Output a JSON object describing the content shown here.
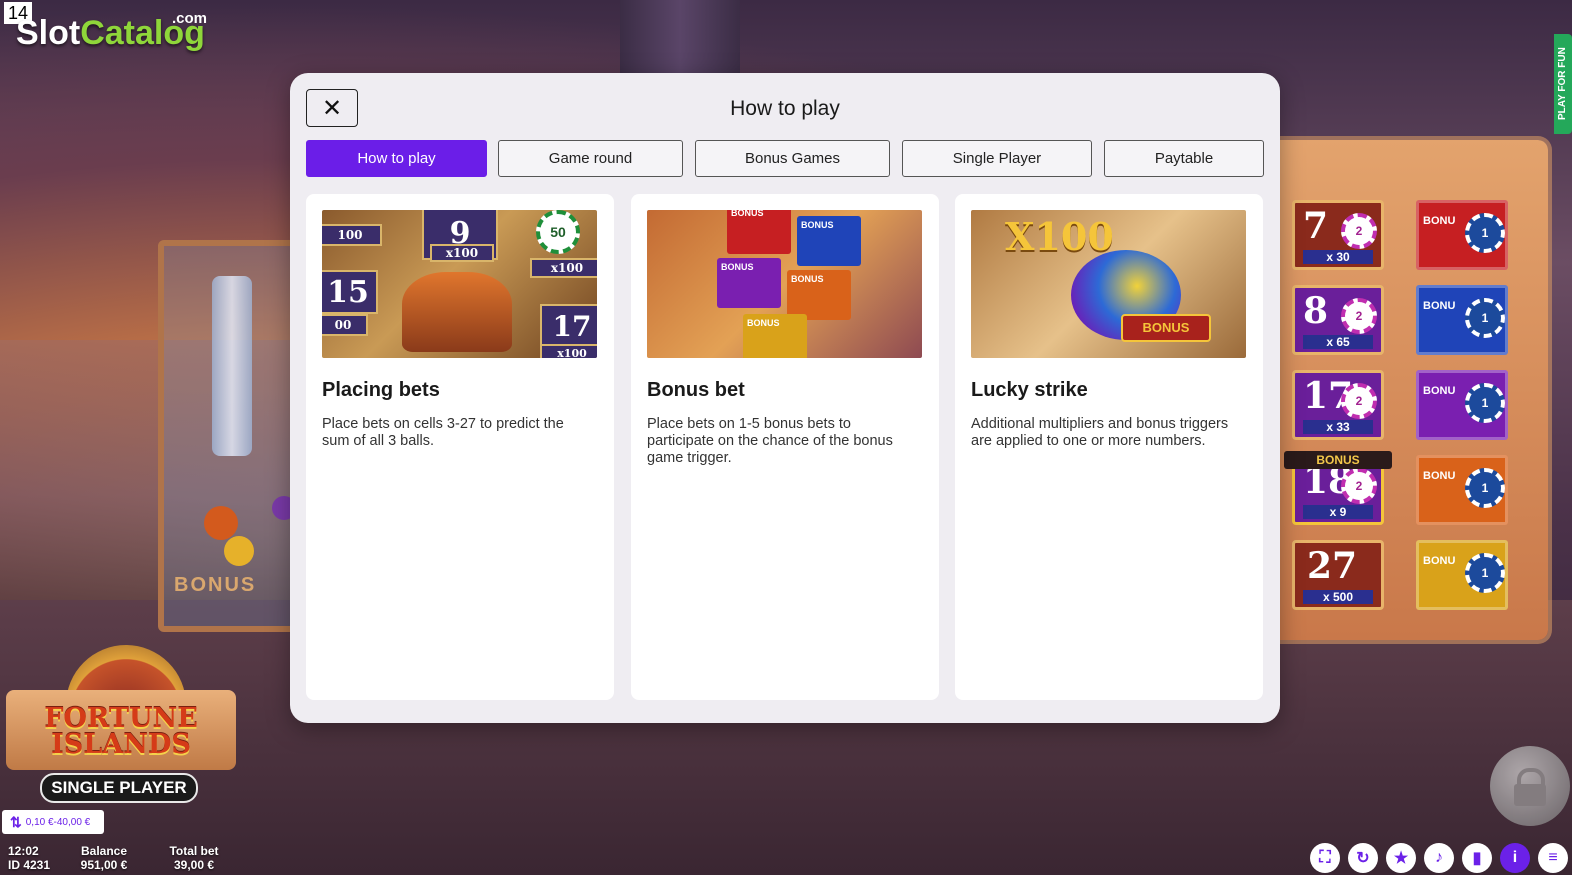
{
  "watermark": {
    "number": "14",
    "slot": "Slot",
    "catalog": "Catalog",
    "com": ".com"
  },
  "side_tab": {
    "label": "PLAY FOR FUN"
  },
  "machine": {
    "bonus_label": "BONUS"
  },
  "game_logo": {
    "line1": "FORTUNE",
    "line2": "ISLANDS",
    "badge": "SINGLE PLAYER"
  },
  "bet_range": {
    "label": "0,10 €-40,00 €"
  },
  "status": {
    "time": "12:02",
    "id": "ID 4231",
    "balance_label": "Balance",
    "balance_value": "951,00 €",
    "total_bet_label": "Total bet",
    "total_bet_value": "39,00 €"
  },
  "bottom_icons": [
    "fullscreen-icon",
    "autoplay-icon",
    "favorite-icon",
    "sound-icon",
    "stats-icon",
    "info-icon",
    "menu-icon"
  ],
  "board": {
    "numbers": [
      {
        "n": "7",
        "chip": "2",
        "mult": "x 30"
      },
      {
        "n": "8",
        "chip": "2",
        "mult": "x 65"
      },
      {
        "n": "17",
        "chip": "2",
        "mult": "x 33"
      },
      {
        "n": "18",
        "chip": "2",
        "mult": "x 9",
        "ribbon": "BONUS"
      },
      {
        "n": "27",
        "chip": "",
        "mult": "x 500"
      }
    ],
    "bonus_tiles": [
      {
        "label": "BONU",
        "chip": "1",
        "color": "#c61f22"
      },
      {
        "label": "BONU",
        "chip": "1",
        "color": "#1f44b8"
      },
      {
        "label": "BONU",
        "chip": "1",
        "color": "#7a1fb0"
      },
      {
        "label": "BONU",
        "chip": "1",
        "color": "#d9621a"
      },
      {
        "label": "BONU",
        "chip": "1",
        "color": "#d9a21a"
      }
    ]
  },
  "modal": {
    "title": "How to play",
    "close_glyph": "✕",
    "tabs": [
      "How to play",
      "Game round",
      "Bonus Games",
      "Single Player",
      "Paytable"
    ],
    "active_tab": 0,
    "accent": "#6b1ee8",
    "cards": [
      {
        "heading": "Placing bets",
        "text": "Place bets on cells 3-27 to predict the sum of all 3 balls.",
        "pic_labels": [
          "9",
          "x100",
          "50",
          "100",
          "15",
          "00",
          "x100",
          "17",
          "x100"
        ]
      },
      {
        "heading": "Bonus bet",
        "text": "Place bets on 1-5 bonus bets to participate on the chance of the bonus game trigger.",
        "pic_labels": [
          "BONUS",
          "BONUS",
          "BONUS",
          "BONUS",
          "BONUS"
        ]
      },
      {
        "heading": "Lucky strike",
        "text": "Additional multipliers and bonus triggers are applied to one or more numbers.",
        "pic_labels": [
          "X100",
          "BONUS"
        ]
      }
    ]
  }
}
